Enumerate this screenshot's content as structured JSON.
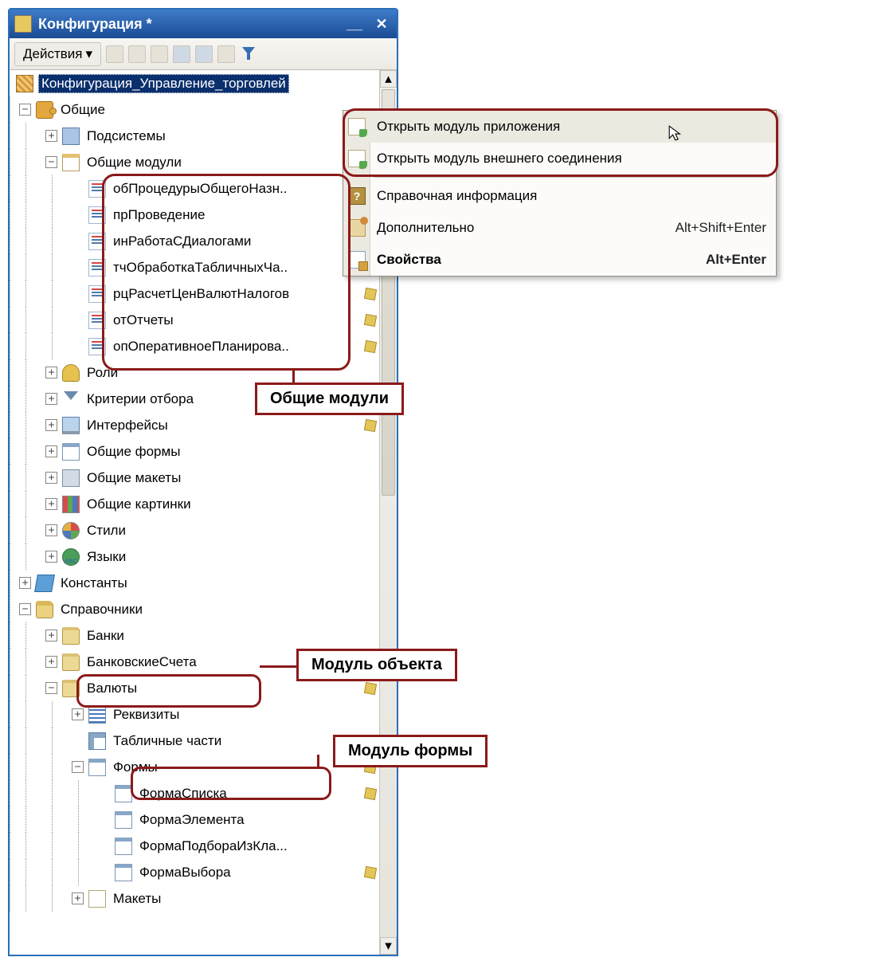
{
  "window": {
    "title": "Конфигурация *"
  },
  "toolbar": {
    "actions": "Действия"
  },
  "tree": {
    "root": "Конфигурация_Управление_торговлей",
    "common": "Общие",
    "subsystems": "Подсистемы",
    "common_modules": "Общие модули",
    "mods": [
      "обПроцедурыОбщегоНазн..",
      "прПроведение",
      "инРаботаСДиалогами",
      "тчОбработкаТабличныхЧа..",
      "рцРасчетЦенВалютНалогов",
      "отОтчеты",
      "опОперативноеПланирова.."
    ],
    "roles": "Роли",
    "criteria": "Критерии отбора",
    "interfaces": "Интерфейсы",
    "common_forms": "Общие формы",
    "common_templates": "Общие макеты",
    "common_pictures": "Общие картинки",
    "styles": "Стили",
    "languages": "Языки",
    "constants": "Константы",
    "catalogs": "Справочники",
    "banks": "Банки",
    "bank_accounts": "БанковскиеСчета",
    "currencies": "Валюты",
    "attributes": "Реквизиты",
    "tabular_parts": "Табличные части",
    "forms": "Формы",
    "form_list": "ФормаСписка",
    "form_elem": "ФормаЭлемента",
    "form_choose": "ФормаПодбораИзКла...",
    "form_select": "ФормаВыбора",
    "templates": "Макеты"
  },
  "ctx": {
    "open_app_module": "Открыть модуль приложения",
    "open_ext_module": "Открыть модуль внешнего соединения",
    "help": "Справочная информация",
    "extra": "Дополнительно",
    "extra_key": "Alt+Shift+Enter",
    "props": "Свойства",
    "props_key": "Alt+Enter"
  },
  "callouts": {
    "common_modules": "Общие модули",
    "object_module": "Модуль объекта",
    "form_module": "Модуль формы"
  }
}
